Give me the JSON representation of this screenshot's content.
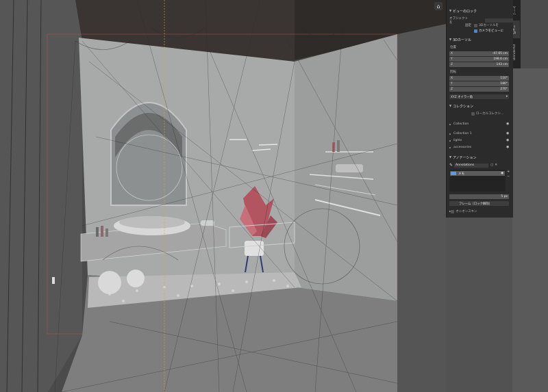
{
  "panel": {
    "top_header": "ビューのロック",
    "lock_object_label": "オブジェクトを",
    "lock_label": "固定",
    "lock_3d_cursor": "3Dカーソルを",
    "camera_to_view": "カメラをビューに",
    "cursor_header": "3Dカーソル",
    "location_label": "位置",
    "location": {
      "x": "-47.65 cm",
      "y": "198.6 cm",
      "z": "143 cm"
    },
    "rotation_label": "回転",
    "rotation": {
      "x": "110°",
      "y": "180°",
      "z": "270°"
    },
    "rotation_mode": "XYZ オイラー角",
    "collection_header": "コレクション",
    "local_collection": "ローカルコレクシ...",
    "collections": [
      "Collection",
      "Collection 1",
      "lights",
      "accessories"
    ],
    "annotation_header": "アノテーション",
    "annotation_layer": "Annotations",
    "note_item": "メモ",
    "thickness_value": "5 px",
    "frame_mode": "フレーム（ロック解除）",
    "onion_skin": "オニオンスキン",
    "tabs": [
      "ツール",
      "ビュー",
      "BlenderKit"
    ]
  },
  "axes": {
    "x": "X",
    "y": "Y",
    "z": "Z"
  },
  "icons": [
    "camera-icon",
    "eye-icon",
    "checkbox-icon",
    "chevron-down-icon",
    "pencil-icon"
  ],
  "colors": {
    "panel_bg": "#2b2b2b",
    "field_bg": "#545454",
    "accent": "#4a87d3",
    "viewport_bg": "#4b4b4b"
  }
}
